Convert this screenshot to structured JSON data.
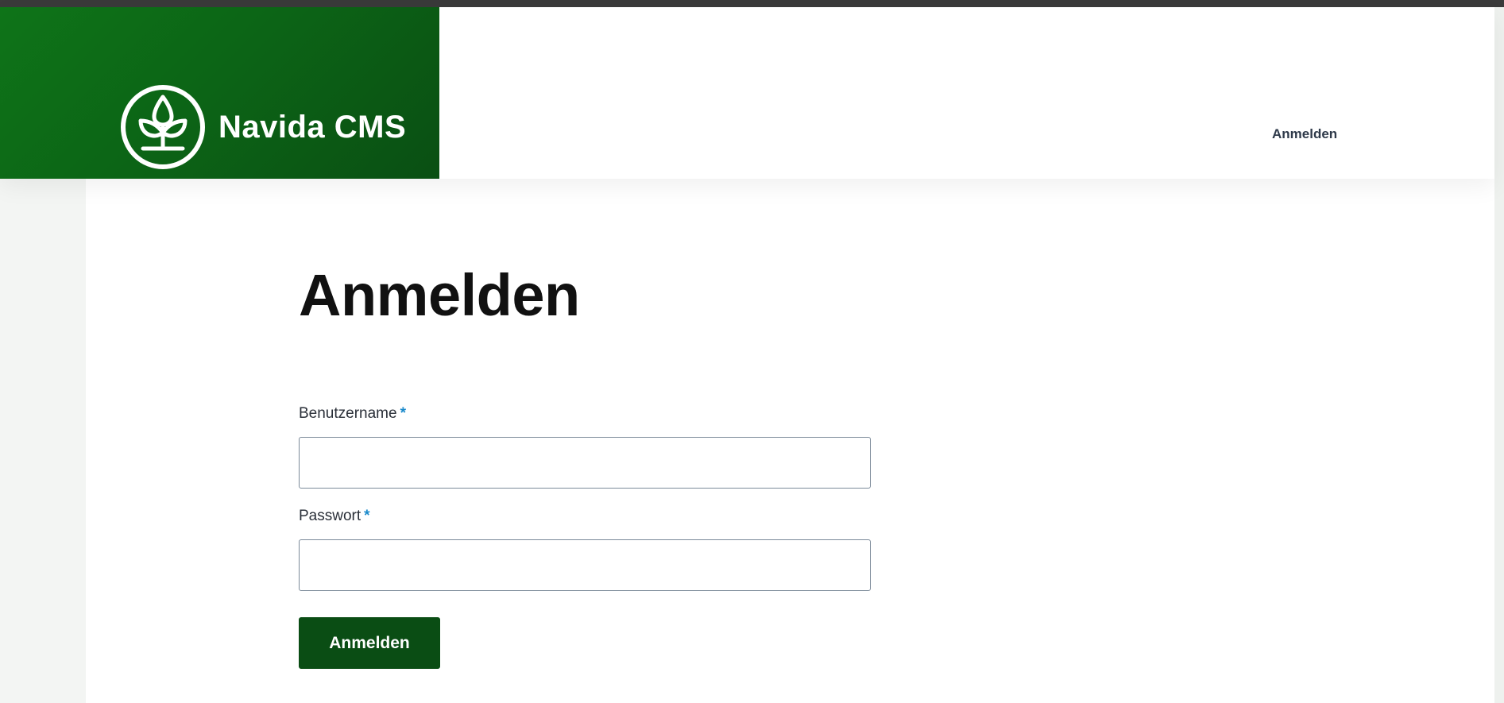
{
  "brand": {
    "name": "Navida CMS",
    "logo_icon": "plant-sprout-circle-icon",
    "color_primary": "#0e7418",
    "color_dark": "#0a4d14"
  },
  "nav": {
    "login_label": "Anmelden"
  },
  "page": {
    "title": "Anmelden"
  },
  "form": {
    "username": {
      "label": "Benutzername",
      "required_mark": "*",
      "value": ""
    },
    "password": {
      "label": "Passwort",
      "required_mark": "*",
      "value": ""
    },
    "submit_label": "Anmelden",
    "required_color": "#1b8acb"
  }
}
